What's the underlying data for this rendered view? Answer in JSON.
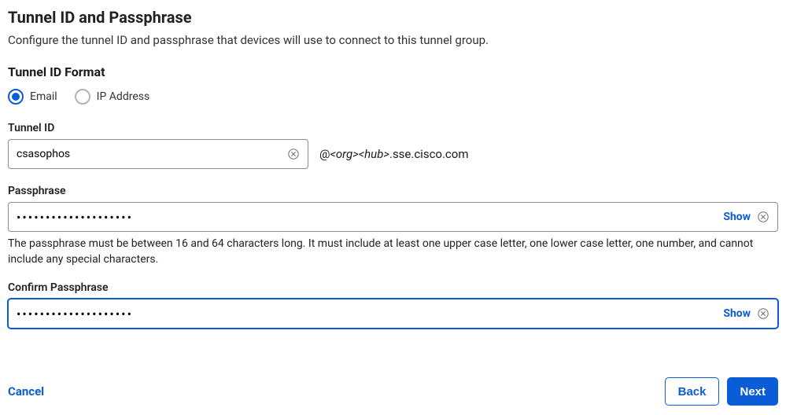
{
  "header": {
    "title": "Tunnel ID and Passphrase",
    "description": "Configure the tunnel ID and passphrase that devices will use to connect to this tunnel group."
  },
  "tunnelIdFormat": {
    "label": "Tunnel ID Format",
    "options": {
      "email": {
        "label": "Email",
        "selected": true
      },
      "ip": {
        "label": "IP Address",
        "selected": false
      }
    }
  },
  "tunnelId": {
    "label": "Tunnel ID",
    "value": "csasophos",
    "suffixPrefix": "@",
    "suffixOrg": "<org>",
    "suffixHub": "<hub>",
    "suffixDomain": ".sse.cisco.com"
  },
  "passphrase": {
    "label": "Passphrase",
    "value": "••••••••••••••••••••",
    "showLabel": "Show",
    "help": "The passphrase must be between 16 and 64 characters long. It must include at least one upper case letter, one lower case letter, one number, and cannot include any special characters."
  },
  "confirmPassphrase": {
    "label": "Confirm Passphrase",
    "value": "••••••••••••••••••••",
    "showLabel": "Show"
  },
  "footer": {
    "cancel": "Cancel",
    "back": "Back",
    "next": "Next"
  }
}
